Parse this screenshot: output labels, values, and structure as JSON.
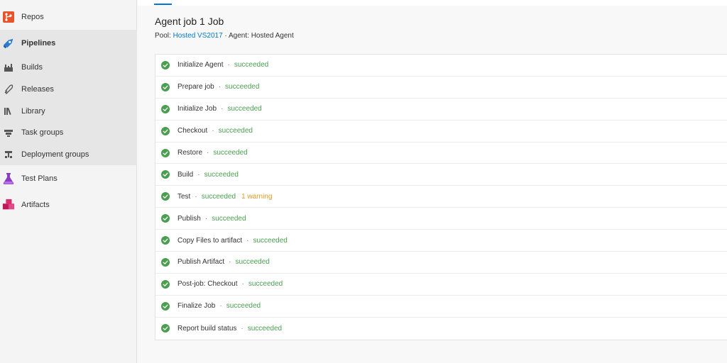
{
  "sidebar": {
    "items": [
      {
        "label": "Repos",
        "icon": "repos-icon"
      },
      {
        "label": "Pipelines",
        "icon": "pipelines-icon"
      },
      {
        "label": "Builds",
        "icon": "builds-icon"
      },
      {
        "label": "Releases",
        "icon": "releases-icon"
      },
      {
        "label": "Library",
        "icon": "library-icon"
      },
      {
        "label": "Task groups",
        "icon": "task-groups-icon"
      },
      {
        "label": "Deployment groups",
        "icon": "deployment-groups-icon"
      },
      {
        "label": "Test Plans",
        "icon": "test-plans-icon"
      },
      {
        "label": "Artifacts",
        "icon": "artifacts-icon"
      }
    ]
  },
  "job": {
    "title": "Agent job 1 Job",
    "pool_label": "Pool:",
    "pool_value": "Hosted VS2017",
    "separator": "·",
    "agent_label": "Agent:",
    "agent_value": "Hosted Agent"
  },
  "steps": [
    {
      "name": "Initialize Agent",
      "status": "succeeded"
    },
    {
      "name": "Prepare job",
      "status": "succeeded"
    },
    {
      "name": "Initialize Job",
      "status": "succeeded"
    },
    {
      "name": "Checkout",
      "status": "succeeded"
    },
    {
      "name": "Restore",
      "status": "succeeded"
    },
    {
      "name": "Build",
      "status": "succeeded"
    },
    {
      "name": "Test",
      "status": "succeeded",
      "warning": "1 warning"
    },
    {
      "name": "Publish",
      "status": "succeeded"
    },
    {
      "name": "Copy Files to artifact",
      "status": "succeeded"
    },
    {
      "name": "Publish Artifact",
      "status": "succeeded"
    },
    {
      "name": "Post-job: Checkout",
      "status": "succeeded"
    },
    {
      "name": "Finalize Job",
      "status": "succeeded"
    },
    {
      "name": "Report build status",
      "status": "succeeded"
    }
  ],
  "colors": {
    "accent": "#0078d4",
    "success": "#4a9e4f",
    "warning": "#e09a2b"
  }
}
